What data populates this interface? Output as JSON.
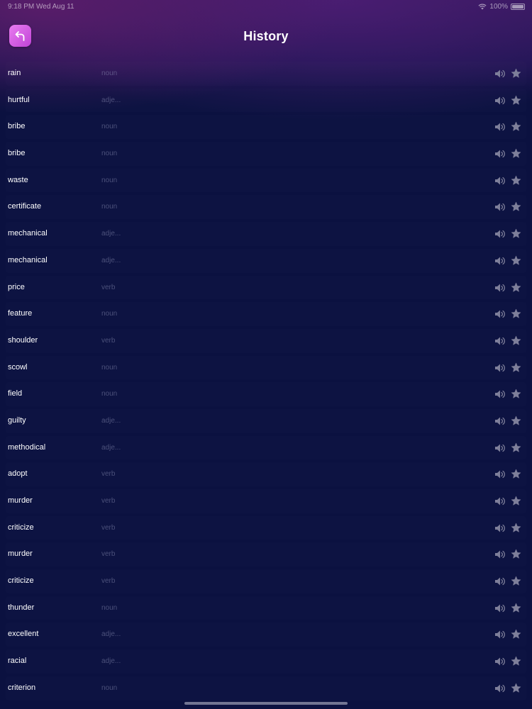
{
  "status_bar": {
    "time_date": "9:18 PM  Wed Aug 11",
    "battery": "100%"
  },
  "header": {
    "title": "History",
    "back_icon": "arrow-uturn-left-icon"
  },
  "colors": {
    "back_button": "#d35ee3",
    "background": "#0b1140",
    "header_gradient": "#2f1858",
    "muted_text": "#969bbe",
    "action_icons": "#7e7f9a"
  },
  "row_icons": {
    "speaker": "speaker-icon",
    "favorite": "star-icon"
  },
  "history": [
    {
      "word": "rain",
      "pos": "noun"
    },
    {
      "word": "hurtful",
      "pos": "adje..."
    },
    {
      "word": "bribe",
      "pos": "noun"
    },
    {
      "word": "bribe",
      "pos": "noun"
    },
    {
      "word": "waste",
      "pos": "noun"
    },
    {
      "word": "certificate",
      "pos": "noun"
    },
    {
      "word": "mechanical",
      "pos": "adje..."
    },
    {
      "word": "mechanical",
      "pos": "adje..."
    },
    {
      "word": "price",
      "pos": "verb"
    },
    {
      "word": "feature",
      "pos": "noun"
    },
    {
      "word": "shoulder",
      "pos": "verb"
    },
    {
      "word": "scowl",
      "pos": "noun"
    },
    {
      "word": "field",
      "pos": "noun"
    },
    {
      "word": "guilty",
      "pos": "adje..."
    },
    {
      "word": "methodical",
      "pos": "adje..."
    },
    {
      "word": "adopt",
      "pos": "verb"
    },
    {
      "word": "murder",
      "pos": "verb"
    },
    {
      "word": "criticize",
      "pos": "verb"
    },
    {
      "word": "murder",
      "pos": "verb"
    },
    {
      "word": "criticize",
      "pos": "verb"
    },
    {
      "word": "thunder",
      "pos": "noun"
    },
    {
      "word": "excellent",
      "pos": "adje..."
    },
    {
      "word": "racial",
      "pos": "adje..."
    },
    {
      "word": "criterion",
      "pos": "noun"
    }
  ]
}
